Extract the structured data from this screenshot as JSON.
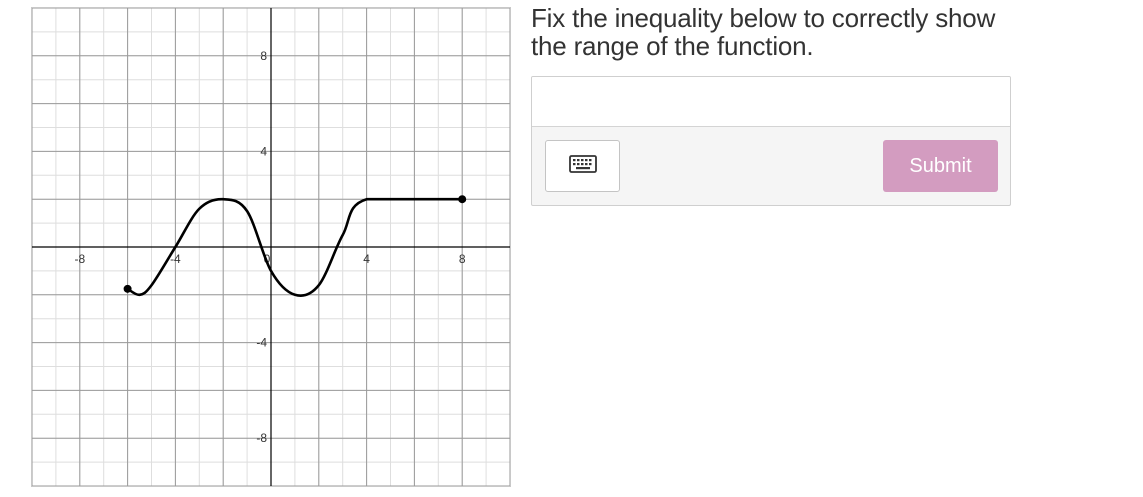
{
  "graph": {
    "x_tick_labels": [
      "-8",
      "-4",
      "0",
      "4",
      "8"
    ],
    "y_tick_labels": [
      "8",
      "4",
      "-4",
      "-8"
    ],
    "x_range": [
      -10,
      10
    ],
    "y_range": [
      -10,
      10
    ],
    "grid_minor_step": 1,
    "grid_major_step": 2,
    "curve_points": [
      [
        -6,
        -1.75
      ],
      [
        -5.5,
        -2
      ],
      [
        -5,
        -1.6
      ],
      [
        -4,
        0
      ],
      [
        -3,
        1.6
      ],
      [
        -2,
        2
      ],
      [
        -1,
        1.5
      ],
      [
        0,
        -1
      ],
      [
        1,
        -2
      ],
      [
        2,
        -1.6
      ],
      [
        3,
        0.5
      ],
      [
        4,
        2
      ],
      [
        8,
        2
      ]
    ],
    "endpoints": [
      [
        -6,
        -1.75
      ],
      [
        8,
        2
      ]
    ]
  },
  "question": {
    "prompt": "Fix the inequality below to correctly show the range of the function."
  },
  "answer": {
    "input_value": "",
    "keyboard_icon": "keyboard-icon",
    "submit_label": "Submit",
    "submit_color": "#d39cc0"
  }
}
